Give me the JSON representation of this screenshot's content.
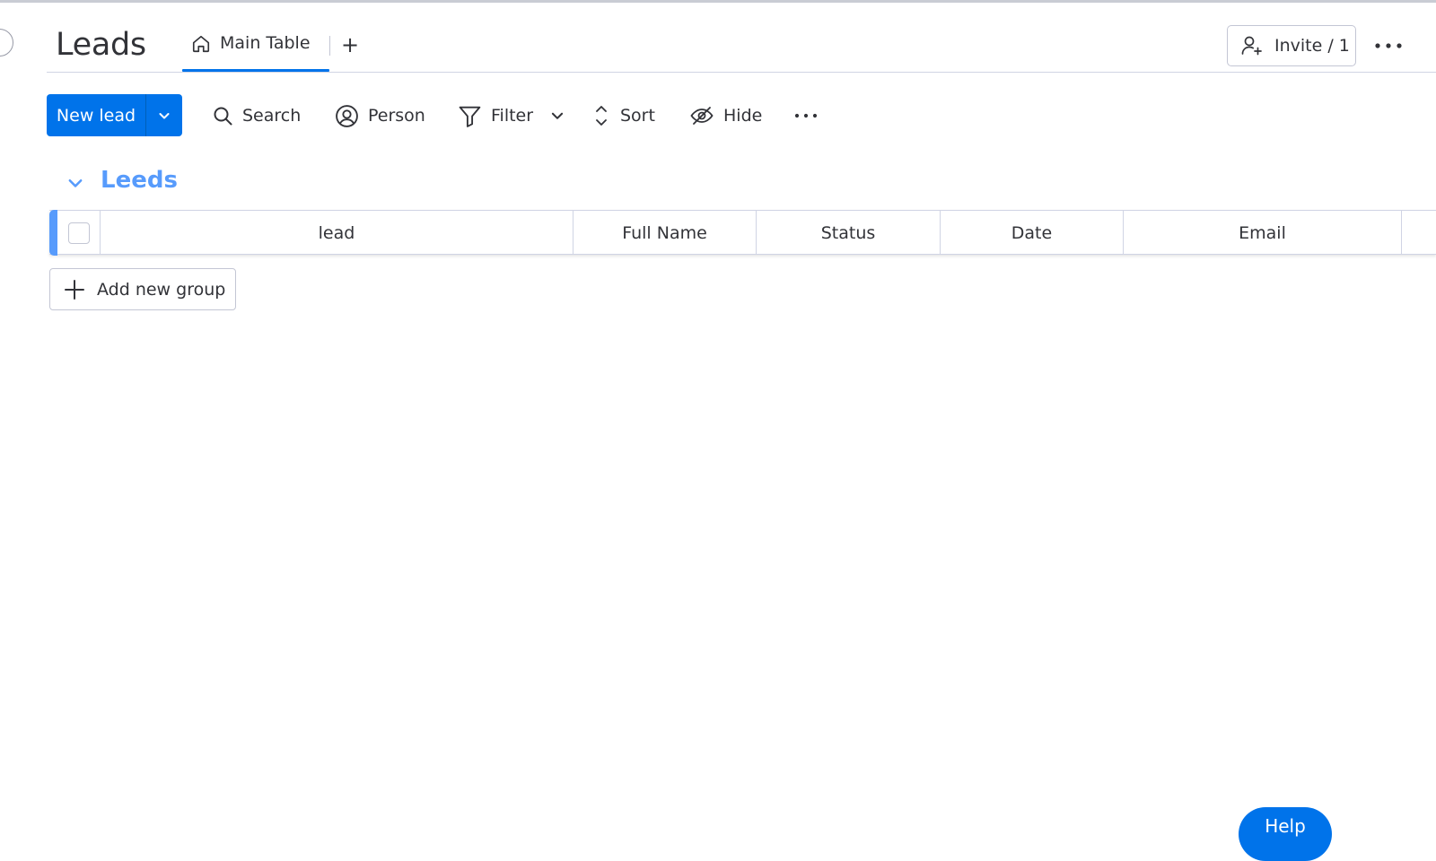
{
  "board": {
    "title": "Leads",
    "tabs": [
      {
        "label": "Main Table",
        "icon": "home-icon",
        "active": true
      }
    ],
    "add_tab_label": "+",
    "invite_label": "Invite / 1"
  },
  "toolbar": {
    "new_item_label": "New lead",
    "search_label": "Search",
    "person_label": "Person",
    "filter_label": "Filter",
    "sort_label": "Sort",
    "hide_label": "Hide"
  },
  "group": {
    "title": "Leeds",
    "color": "#579bfc",
    "columns": [
      "lead",
      "Full Name",
      "Status",
      "Date",
      "Email"
    ]
  },
  "add_group_label": "Add new group",
  "help_label": "Help",
  "colors": {
    "primary": "#0073ea",
    "group": "#579bfc",
    "text": "#323338",
    "border": "#d0d4e4"
  }
}
